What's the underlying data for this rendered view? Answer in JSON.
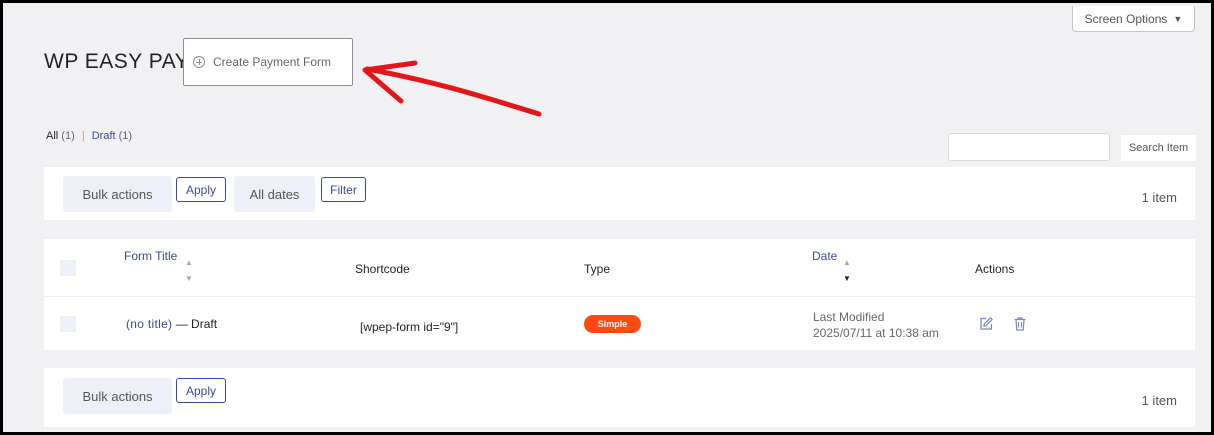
{
  "header": {
    "screen_options_label": "Screen Options",
    "page_title": "WP EASY PAY",
    "create_button_label": "Create Payment Form"
  },
  "views": {
    "all_label": "All",
    "all_count": "(1)",
    "draft_label": "Draft",
    "draft_count": "(1)"
  },
  "search": {
    "placeholder": "",
    "button_label": "Search Item"
  },
  "top_toolbar": {
    "bulk_actions_label": "Bulk actions",
    "apply_label": "Apply",
    "dates_label": "All dates",
    "filter_label": "Filter",
    "item_count": "1 item"
  },
  "table": {
    "columns": {
      "form_title": "Form Title",
      "shortcode": "Shortcode",
      "type": "Type",
      "date": "Date",
      "actions": "Actions"
    },
    "rows": [
      {
        "title": "(no title)",
        "state": " — Draft",
        "shortcode": "[wpep-form id=\"9\"]",
        "type": "Simple",
        "date_label": "Last Modified",
        "date_value": "2025/07/11 at 10:38 am"
      }
    ]
  },
  "bottom_toolbar": {
    "bulk_actions_label": "Bulk actions",
    "apply_label": "Apply",
    "item_count": "1 item"
  },
  "colors": {
    "accent": "#3c4a9e",
    "badge": "#ff4b12",
    "annotation_arrow": "#e3161b"
  },
  "icons": {
    "create": "plus-circle-icon",
    "edit": "edit-icon",
    "delete": "trash-icon"
  }
}
